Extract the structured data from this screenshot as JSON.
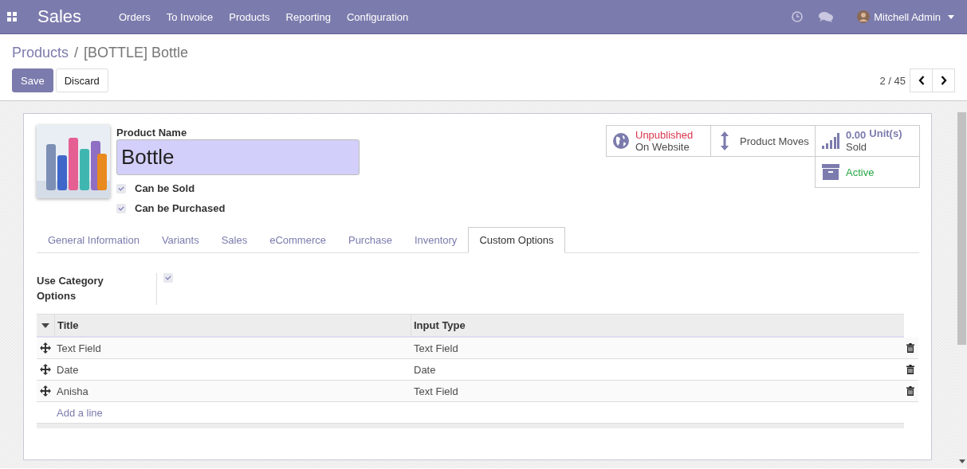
{
  "navbar": {
    "app": "Sales",
    "menu": [
      "Orders",
      "To Invoice",
      "Products",
      "Reporting",
      "Configuration"
    ],
    "user": "Mitchell Admin"
  },
  "breadcrumb": {
    "items": [
      "Products",
      "[BOTTLE] Bottle"
    ],
    "separator": "/"
  },
  "buttons": [
    {
      "label": "Save",
      "kind": "primary"
    },
    {
      "label": "Discard",
      "kind": "secondary"
    }
  ],
  "pager": {
    "value": "2 / 45"
  },
  "form": {
    "name_label": "Product Name",
    "name": "Bottle",
    "checkboxes": [
      {
        "label": "Can be Sold",
        "checked": true
      },
      {
        "label": "Can be Purchased",
        "checked": true
      }
    ],
    "smart_buttons": [
      {
        "kind": "website",
        "line1": "Unpublished",
        "line2": "On Website"
      },
      {
        "kind": "moves",
        "line1": "Product Moves"
      },
      {
        "kind": "sold",
        "value": "0.00",
        "unit": "Unit(s)",
        "line2": "Sold"
      },
      {
        "kind": "active",
        "line1": "Active"
      }
    ],
    "tabs": [
      {
        "label": "General Information",
        "selected": false
      },
      {
        "label": "Variants",
        "selected": false
      },
      {
        "label": "Sales",
        "selected": false
      },
      {
        "label": "eCommerce",
        "selected": false
      },
      {
        "label": "Purchase",
        "selected": false
      },
      {
        "label": "Inventory",
        "selected": false
      },
      {
        "label": "Custom Options",
        "selected": true
      }
    ],
    "category_option": {
      "label": "Use Category Options",
      "checked": true
    },
    "table": {
      "columns": [
        "Title",
        "Input Type"
      ],
      "rows": [
        {
          "title": "Text Field",
          "input_type": "Text Field"
        },
        {
          "title": "Date",
          "input_type": "Date"
        },
        {
          "title": "Anisha",
          "input_type": "Text Field"
        }
      ],
      "add_line": "Add a line"
    }
  }
}
